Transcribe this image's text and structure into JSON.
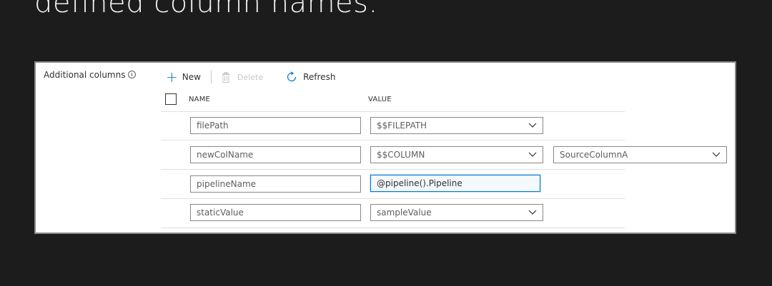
{
  "heading": "defined column names.",
  "additional_columns": {
    "label": "Additional columns",
    "info_icon": "info-icon"
  },
  "toolbar": {
    "new_label": "New",
    "delete_label": "Delete",
    "refresh_label": "Refresh",
    "icons": [
      "plus-icon",
      "trash-icon",
      "refresh-icon"
    ]
  },
  "table": {
    "headers": {
      "name": "NAME",
      "value": "VALUE"
    },
    "rows": [
      {
        "name": "filePath",
        "value": "$$FILEPATH"
      },
      {
        "name": "newColName",
        "value": "$$COLUMN",
        "extra": "SourceColumnA"
      },
      {
        "name": "pipelineName",
        "value": "@pipeline().Pipeline"
      },
      {
        "name": "staticValue",
        "value": "sampleValue"
      }
    ]
  },
  "colors": {
    "accent": "#0078d4",
    "page_background": "#1c1c1c",
    "panel_border": "#8a8a8a"
  }
}
